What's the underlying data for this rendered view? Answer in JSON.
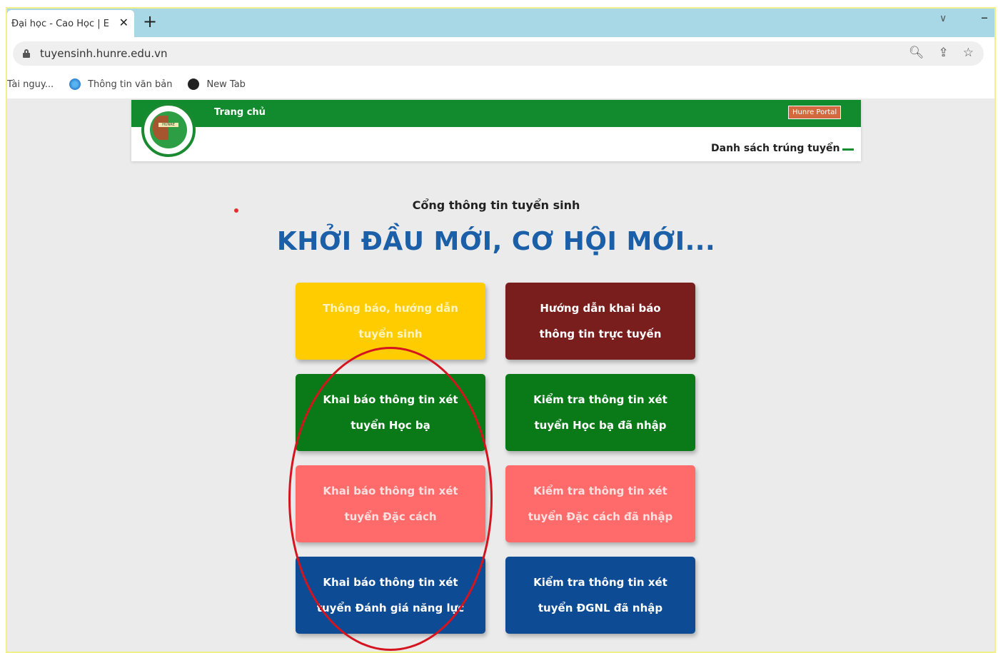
{
  "browser": {
    "tab_title": "Đại học - Cao Học | E",
    "new_tab_symbol": "+",
    "url": "tuyensinh.hunre.edu.vn",
    "bookmarks": [
      {
        "label": "Tài nguy...",
        "icon": "none"
      },
      {
        "label": "Thông tin văn bản",
        "icon": "blue-globe-icon"
      },
      {
        "label": "New Tab",
        "icon": "globe-icon"
      }
    ]
  },
  "header": {
    "nav_home": "Trang chủ",
    "portal_button": "Hunre Portal",
    "list_link": "Danh sách trúng tuyển",
    "logo_text": "HUNRE",
    "accent_color": "#128a2e"
  },
  "hero": {
    "subtitle": "Cổng thông tin tuyển sinh",
    "slogan": "KHỞI ĐẦU MỚI, CƠ HỘI MỚI...",
    "slogan_color": "#1b5fa8"
  },
  "cards": [
    {
      "label": "Thông báo, hướng dẫn tuyển sinh",
      "color": "#ffcc00"
    },
    {
      "label": "Hướng dẫn khai báo thông tin trực tuyến",
      "color": "#7a1d1d"
    },
    {
      "label": "Khai báo thông tin xét tuyển Học bạ",
      "color": "#0a7a18"
    },
    {
      "label": "Kiểm tra thông tin xét tuyển Học bạ đã nhập",
      "color": "#0a7a18"
    },
    {
      "label": "Khai báo thông tin xét tuyển Đặc cách",
      "color": "#ff6b6b"
    },
    {
      "label": "Kiểm tra thông tin xét tuyển Đặc cách đã nhập",
      "color": "#ff6b6b"
    },
    {
      "label": "Khai báo thông tin xét tuyển Đánh giá năng lực",
      "color": "#0d4b94"
    },
    {
      "label": "Kiểm tra thông tin xét tuyển ĐGNL đã nhập",
      "color": "#0d4b94"
    }
  ],
  "annotation": {
    "color": "#d4141e"
  }
}
